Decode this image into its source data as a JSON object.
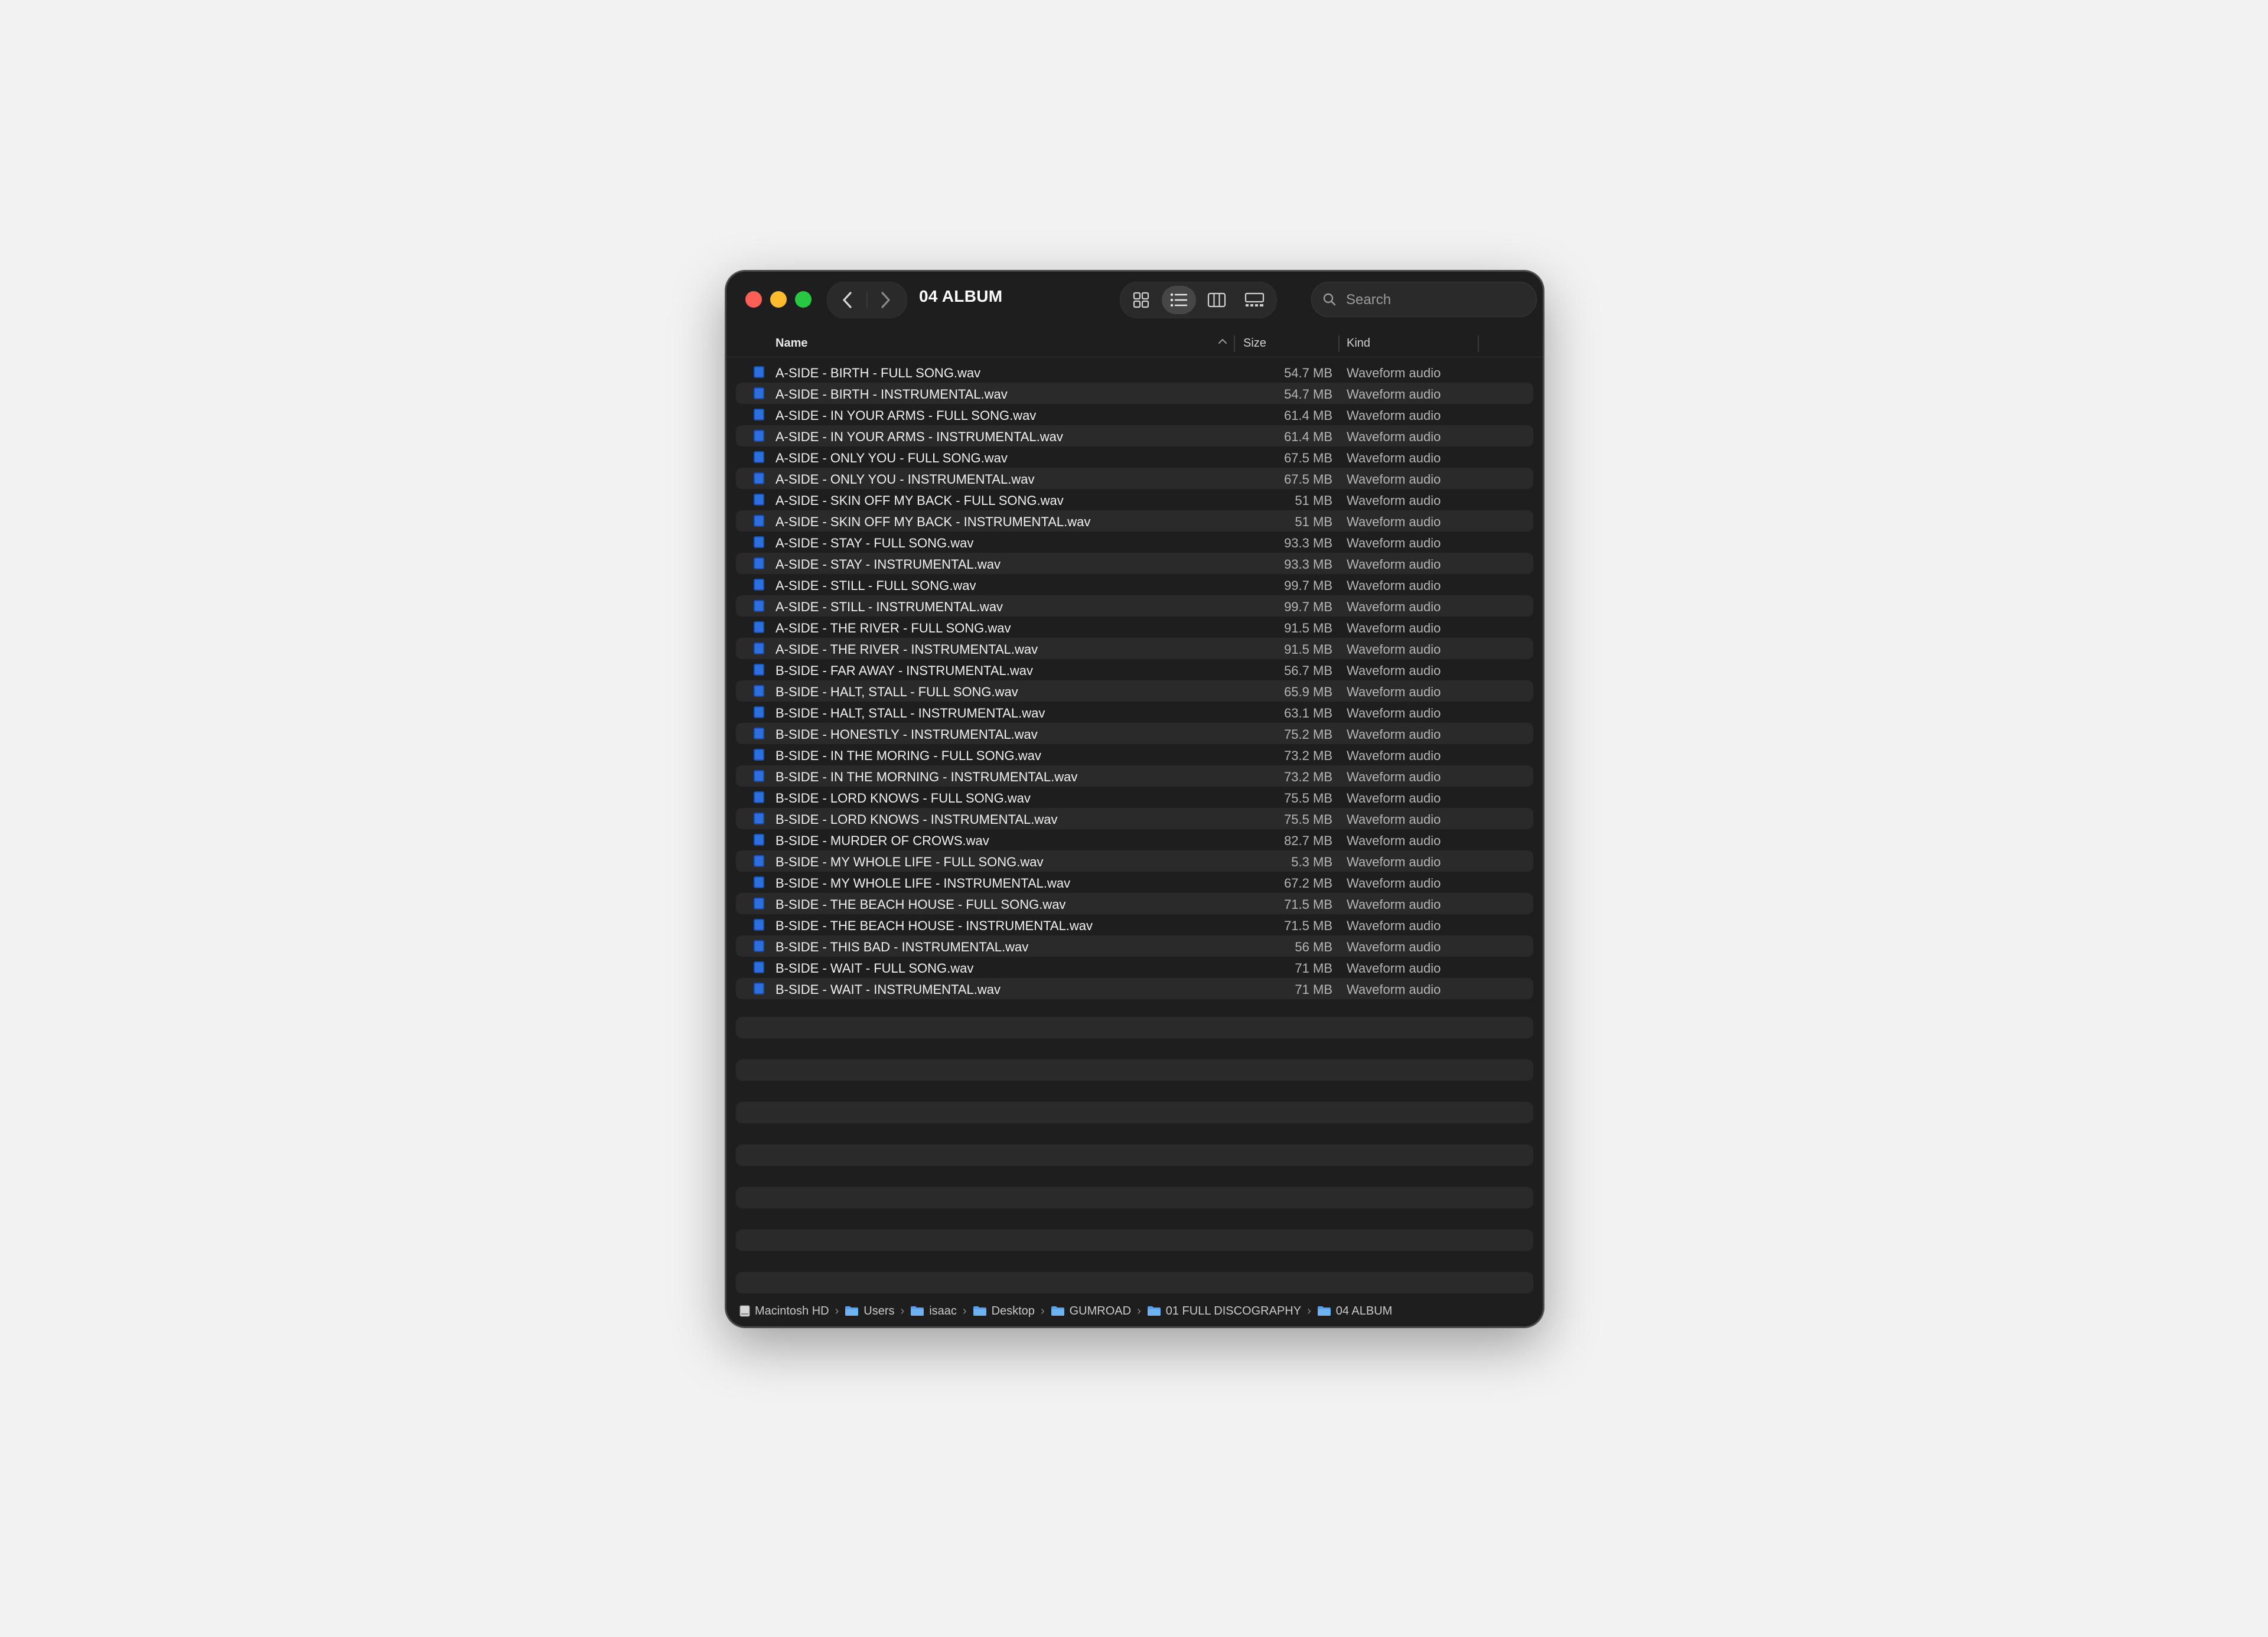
{
  "window": {
    "title": "04 ALBUM"
  },
  "search": {
    "placeholder": "Search"
  },
  "columns": {
    "name": "Name",
    "size": "Size",
    "kind": "Kind"
  },
  "view_modes": [
    "icon-view",
    "list-view",
    "column-view",
    "gallery-view"
  ],
  "active_view": "list-view",
  "files": [
    {
      "name": "A-SIDE - BIRTH - FULL SONG.wav",
      "size": "54.7 MB",
      "kind": "Waveform audio"
    },
    {
      "name": "A-SIDE - BIRTH - INSTRUMENTAL.wav",
      "size": "54.7 MB",
      "kind": "Waveform audio"
    },
    {
      "name": "A-SIDE - IN YOUR ARMS - FULL SONG.wav",
      "size": "61.4 MB",
      "kind": "Waveform audio"
    },
    {
      "name": "A-SIDE - IN YOUR ARMS - INSTRUMENTAL.wav",
      "size": "61.4 MB",
      "kind": "Waveform audio"
    },
    {
      "name": "A-SIDE - ONLY YOU - FULL SONG.wav",
      "size": "67.5 MB",
      "kind": "Waveform audio"
    },
    {
      "name": "A-SIDE - ONLY YOU - INSTRUMENTAL.wav",
      "size": "67.5 MB",
      "kind": "Waveform audio"
    },
    {
      "name": "A-SIDE - SKIN OFF MY BACK - FULL SONG.wav",
      "size": "51 MB",
      "kind": "Waveform audio"
    },
    {
      "name": "A-SIDE - SKIN OFF MY BACK - INSTRUMENTAL.wav",
      "size": "51 MB",
      "kind": "Waveform audio"
    },
    {
      "name": "A-SIDE - STAY - FULL SONG.wav",
      "size": "93.3 MB",
      "kind": "Waveform audio"
    },
    {
      "name": "A-SIDE - STAY - INSTRUMENTAL.wav",
      "size": "93.3 MB",
      "kind": "Waveform audio"
    },
    {
      "name": "A-SIDE - STILL - FULL SONG.wav",
      "size": "99.7 MB",
      "kind": "Waveform audio"
    },
    {
      "name": "A-SIDE - STILL - INSTRUMENTAL.wav",
      "size": "99.7 MB",
      "kind": "Waveform audio"
    },
    {
      "name": "A-SIDE - THE RIVER - FULL SONG.wav",
      "size": "91.5 MB",
      "kind": "Waveform audio"
    },
    {
      "name": "A-SIDE - THE RIVER - INSTRUMENTAL.wav",
      "size": "91.5 MB",
      "kind": "Waveform audio"
    },
    {
      "name": "B-SIDE - FAR AWAY - INSTRUMENTAL.wav",
      "size": "56.7 MB",
      "kind": "Waveform audio"
    },
    {
      "name": "B-SIDE - HALT, STALL - FULL SONG.wav",
      "size": "65.9 MB",
      "kind": "Waveform audio"
    },
    {
      "name": "B-SIDE - HALT, STALL - INSTRUMENTAL.wav",
      "size": "63.1 MB",
      "kind": "Waveform audio"
    },
    {
      "name": "B-SIDE - HONESTLY - INSTRUMENTAL.wav",
      "size": "75.2 MB",
      "kind": "Waveform audio"
    },
    {
      "name": "B-SIDE - IN THE MORING - FULL SONG.wav",
      "size": "73.2 MB",
      "kind": "Waveform audio"
    },
    {
      "name": "B-SIDE - IN THE MORNING - INSTRUMENTAL.wav",
      "size": "73.2 MB",
      "kind": "Waveform audio"
    },
    {
      "name": "B-SIDE - LORD KNOWS - FULL SONG.wav",
      "size": "75.5 MB",
      "kind": "Waveform audio"
    },
    {
      "name": "B-SIDE - LORD KNOWS - INSTRUMENTAL.wav",
      "size": "75.5 MB",
      "kind": "Waveform audio"
    },
    {
      "name": "B-SIDE - MURDER OF CROWS.wav",
      "size": "82.7 MB",
      "kind": "Waveform audio"
    },
    {
      "name": "B-SIDE - MY WHOLE LIFE - FULL SONG.wav",
      "size": "5.3 MB",
      "kind": "Waveform audio"
    },
    {
      "name": "B-SIDE - MY WHOLE LIFE - INSTRUMENTAL.wav",
      "size": "67.2 MB",
      "kind": "Waveform audio"
    },
    {
      "name": "B-SIDE - THE BEACH HOUSE - FULL SONG.wav",
      "size": "71.5 MB",
      "kind": "Waveform audio"
    },
    {
      "name": "B-SIDE - THE BEACH HOUSE - INSTRUMENTAL.wav",
      "size": "71.5 MB",
      "kind": "Waveform audio"
    },
    {
      "name": "B-SIDE - THIS BAD - INSTRUMENTAL.wav",
      "size": "56 MB",
      "kind": "Waveform audio"
    },
    {
      "name": "B-SIDE - WAIT - FULL SONG.wav",
      "size": "71 MB",
      "kind": "Waveform audio"
    },
    {
      "name": "B-SIDE - WAIT - INSTRUMENTAL.wav",
      "size": "71 MB",
      "kind": "Waveform audio"
    }
  ],
  "path": [
    {
      "label": "Macintosh HD",
      "icon": "disk-icon"
    },
    {
      "label": "Users",
      "icon": "folder-icon"
    },
    {
      "label": "isaac",
      "icon": "folder-icon"
    },
    {
      "label": "Desktop",
      "icon": "folder-icon"
    },
    {
      "label": "GUMROAD",
      "icon": "folder-icon"
    },
    {
      "label": "01 FULL DISCOGRAPHY",
      "icon": "folder-icon"
    },
    {
      "label": "04 ALBUM",
      "icon": "folder-icon"
    }
  ],
  "colors": {
    "window_bg": "#1e1e1e",
    "row_alt": "#2a2a2a",
    "file_icon": "#2f6fdd",
    "folder_icon": "#5aa0e6",
    "close": "#ff5f57",
    "minimize": "#febc2e",
    "maximize": "#28c840"
  }
}
